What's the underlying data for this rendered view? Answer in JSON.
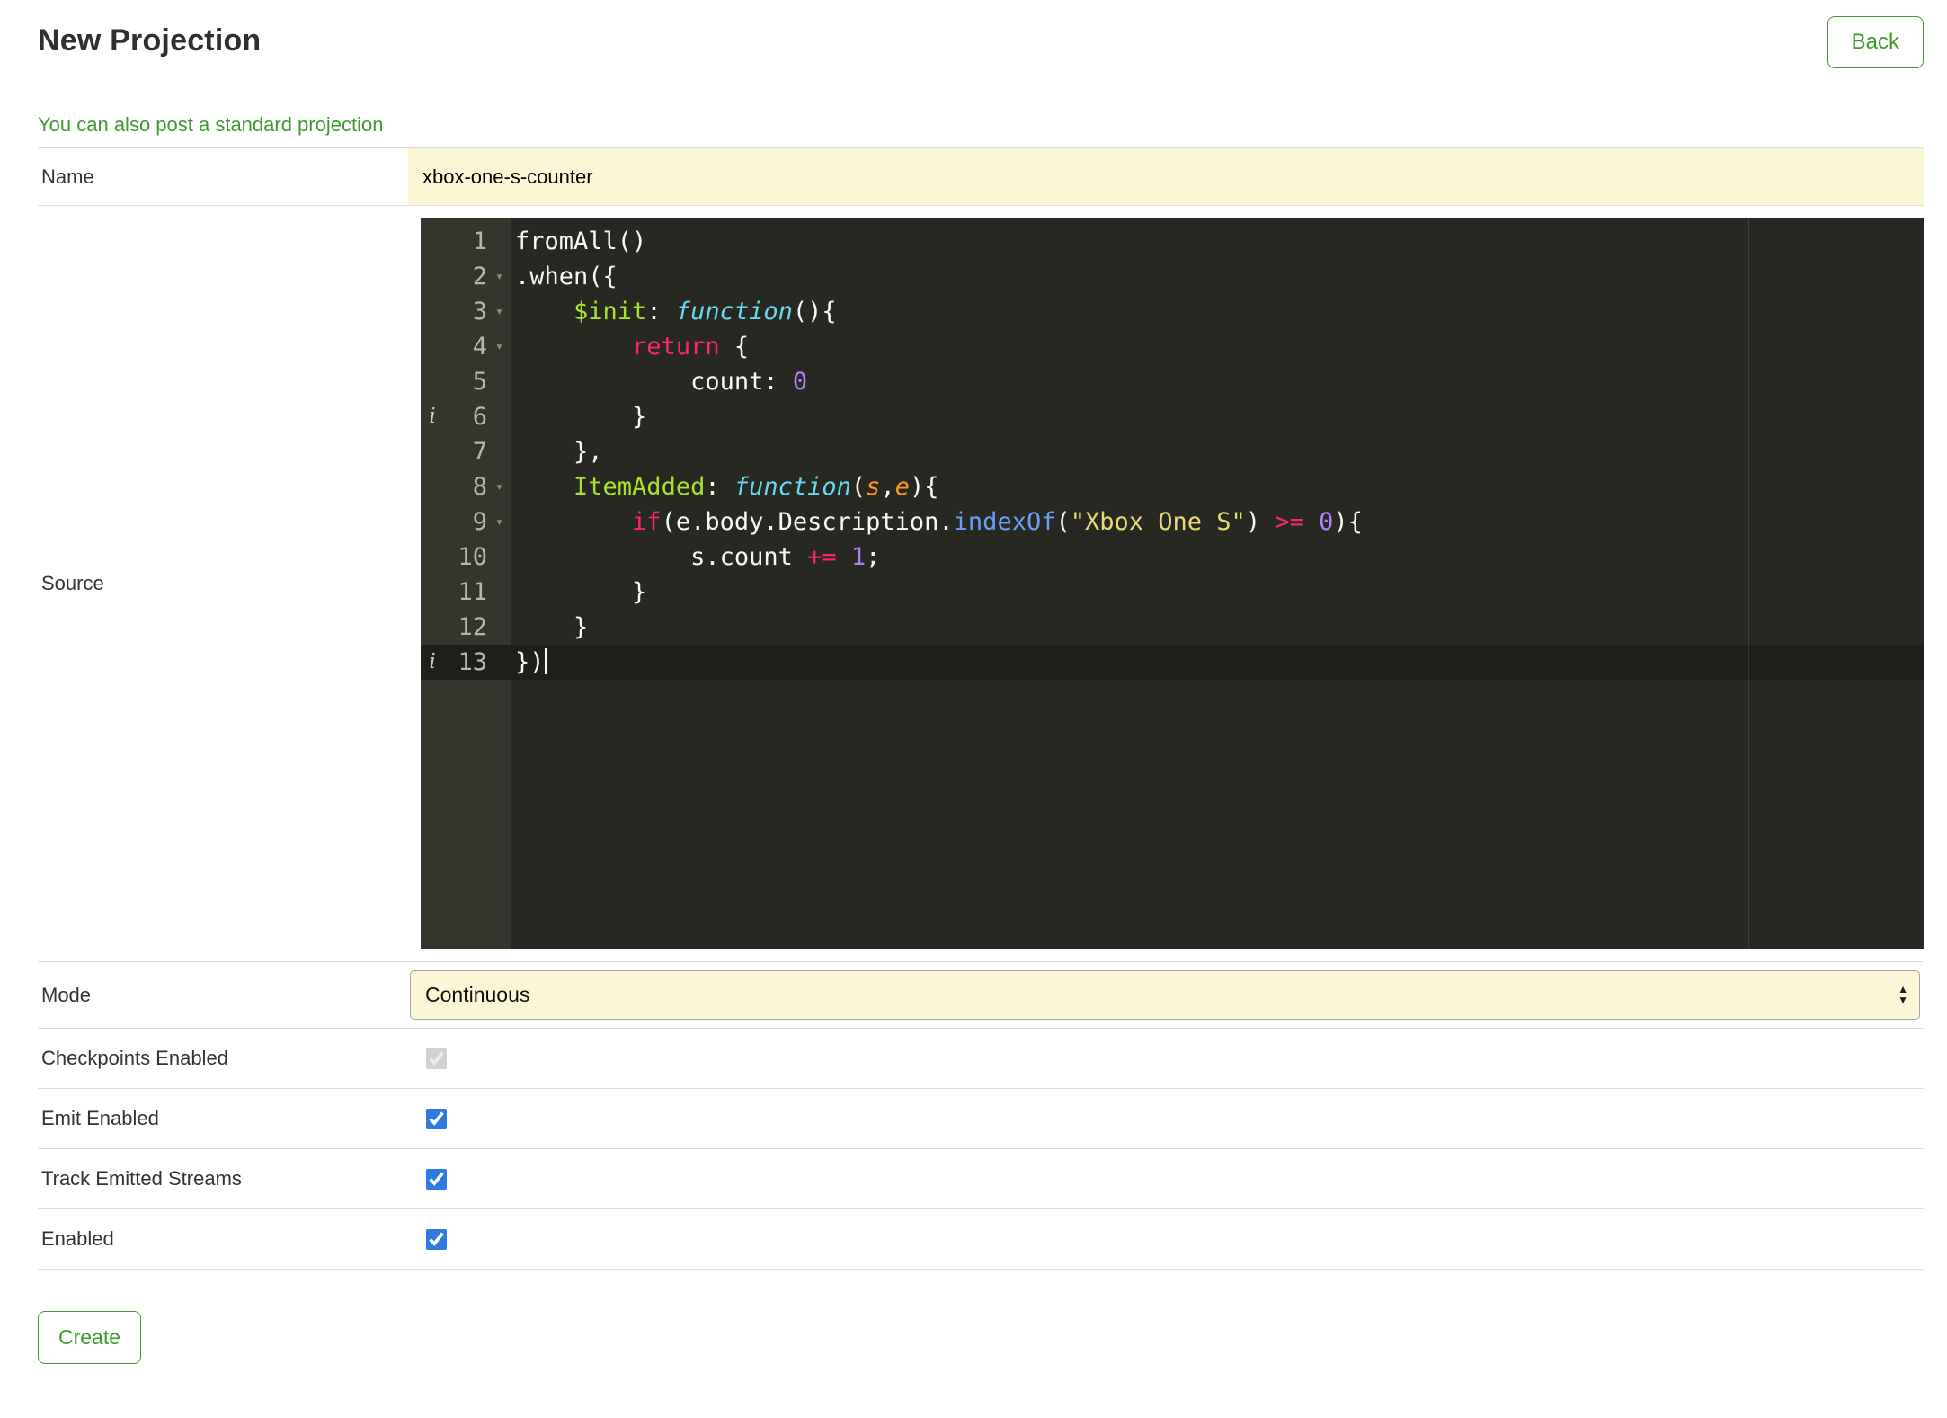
{
  "colors": {
    "accent_green": "#3c9b2d",
    "row_border": "#dddddd",
    "field_yellow": "#fbf7d5",
    "checkbox_blue": "#2e7be0",
    "editor_bg": "#272822",
    "editor_gutter_bg": "#34352c",
    "editor_active_line_bg": "#1e1f19"
  },
  "header": {
    "title": "New Projection",
    "back_label": "Back"
  },
  "link_text": "You can also post a standard projection",
  "form": {
    "name": {
      "label": "Name",
      "value": "xbox-one-s-counter"
    },
    "source": {
      "label": "Source"
    },
    "mode": {
      "label": "Mode",
      "value": "Continuous"
    },
    "checkpoints": {
      "label": "Checkpoints Enabled",
      "checked": true,
      "disabled": true
    },
    "emit": {
      "label": "Emit Enabled",
      "checked": true,
      "disabled": false
    },
    "track": {
      "label": "Track Emitted Streams",
      "checked": true,
      "disabled": false
    },
    "enabled": {
      "label": "Enabled",
      "checked": true,
      "disabled": false
    },
    "create_label": "Create"
  },
  "editor": {
    "fold_glyph": "▾",
    "info_glyph": "i",
    "italics": [
      "fn",
      "param"
    ],
    "palette": {
      "plain": "#f8f8f2",
      "kw": "#f92672",
      "fn": "#66d9ef",
      "prop": "#a6e22e",
      "str": "#e6db74",
      "num": "#ae81ff",
      "param": "#fd971f",
      "method": "#6a9ff5"
    },
    "lines": [
      {
        "n": 1,
        "tokens": [
          [
            "plain",
            "fromAll()"
          ]
        ]
      },
      {
        "n": 2,
        "fold": true,
        "tokens": [
          [
            "plain",
            ".when({"
          ]
        ]
      },
      {
        "n": 3,
        "fold": true,
        "tokens": [
          [
            "plain",
            "    "
          ],
          [
            "prop",
            "$init"
          ],
          [
            "plain",
            ": "
          ],
          [
            "fn",
            "function"
          ],
          [
            "plain",
            "(){"
          ]
        ]
      },
      {
        "n": 4,
        "fold": true,
        "tokens": [
          [
            "plain",
            "        "
          ],
          [
            "kw",
            "return"
          ],
          [
            "plain",
            " {"
          ]
        ]
      },
      {
        "n": 5,
        "tokens": [
          [
            "plain",
            "            count: "
          ],
          [
            "num",
            "0"
          ]
        ]
      },
      {
        "n": 6,
        "info": true,
        "tokens": [
          [
            "plain",
            "        }"
          ]
        ]
      },
      {
        "n": 7,
        "tokens": [
          [
            "plain",
            "    },"
          ]
        ]
      },
      {
        "n": 8,
        "fold": true,
        "tokens": [
          [
            "plain",
            "    "
          ],
          [
            "prop",
            "ItemAdded"
          ],
          [
            "plain",
            ": "
          ],
          [
            "fn",
            "function"
          ],
          [
            "plain",
            "("
          ],
          [
            "param",
            "s"
          ],
          [
            "plain",
            ","
          ],
          [
            "param",
            "e"
          ],
          [
            "plain",
            "){"
          ]
        ]
      },
      {
        "n": 9,
        "fold": true,
        "tokens": [
          [
            "plain",
            "        "
          ],
          [
            "kw",
            "if"
          ],
          [
            "plain",
            "(e.body.Description."
          ],
          [
            "method",
            "indexOf"
          ],
          [
            "plain",
            "("
          ],
          [
            "str",
            "\"Xbox One S\""
          ],
          [
            "plain",
            ") "
          ],
          [
            "kw",
            ">="
          ],
          [
            "plain",
            " "
          ],
          [
            "num",
            "0"
          ],
          [
            "plain",
            "){"
          ]
        ]
      },
      {
        "n": 10,
        "tokens": [
          [
            "plain",
            "            s.count "
          ],
          [
            "kw",
            "+="
          ],
          [
            "plain",
            " "
          ],
          [
            "num",
            "1"
          ],
          [
            "plain",
            ";"
          ]
        ]
      },
      {
        "n": 11,
        "tokens": [
          [
            "plain",
            "        }"
          ]
        ]
      },
      {
        "n": 12,
        "tokens": [
          [
            "plain",
            "    }"
          ]
        ]
      },
      {
        "n": 13,
        "info": true,
        "active": true,
        "cursor": true,
        "tokens": [
          [
            "plain",
            "})"
          ]
        ]
      }
    ]
  }
}
